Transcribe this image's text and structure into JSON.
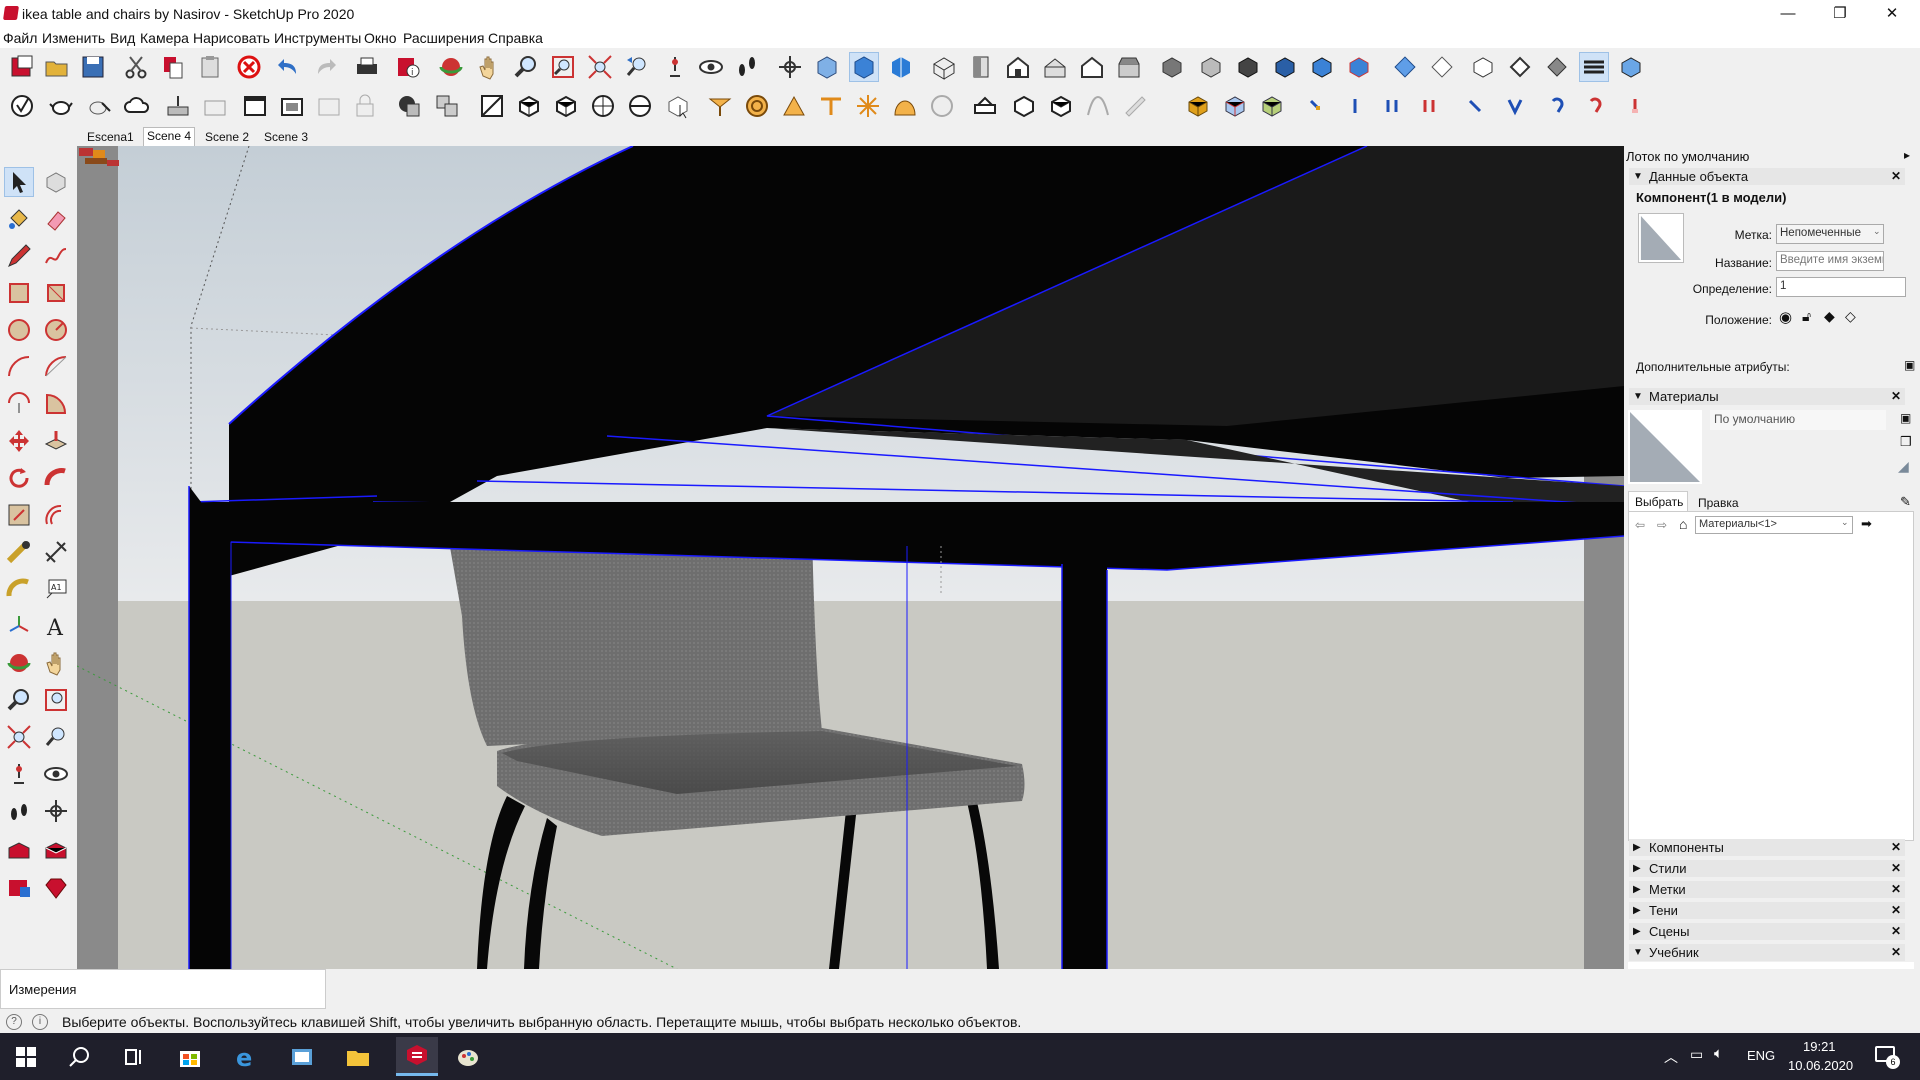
{
  "window": {
    "title": "ikea table and chairs by Nasirov - SketchUp Pro 2020",
    "minimize_glyph": "—",
    "maximize_glyph": "❐",
    "close_glyph": "✕"
  },
  "menu": [
    "Файл",
    "Изменить",
    "Вид",
    "Камера",
    "Нарисовать",
    "Инструменты",
    "Окно",
    "Расширения",
    "Справка"
  ],
  "scenes": {
    "tabs": [
      "Escena1",
      "Scene 4",
      "Scene 2",
      "Scene 3"
    ],
    "active": "Scene 4"
  },
  "tray": {
    "title": "Лоток по умолчанию",
    "entity_info": {
      "header": "Данные объекта",
      "component_title": "Компонент(1 в модели)",
      "tag_label": "Метка:",
      "tag_value": "Непомеченные",
      "name_label": "Название:",
      "name_placeholder": "Введите имя экземпляра",
      "definition_label": "Определение:",
      "definition_value": "1",
      "position_label": "Положение:",
      "extra_attributes": "Дополнительные атрибуты:"
    },
    "materials": {
      "header": "Материалы",
      "default_name": "По умолчанию",
      "tab_select": "Выбрать",
      "tab_edit": "Правка",
      "library": "Материалы<1>"
    },
    "collapsed_panels": [
      "Компоненты",
      "Стили",
      "Метки",
      "Тени",
      "Сцены"
    ],
    "instructor": {
      "header": "Учебник"
    }
  },
  "measurements_label": "Измерения",
  "status_text": "Выберите объекты. Воспользуйтесь клавишей Shift, чтобы увеличить выбранную область. Перетащите мышь, чтобы выбрать несколько объектов.",
  "taskbar": {
    "language": "ENG",
    "time": "19:21",
    "date": "10.06.2020",
    "notifications": "6"
  },
  "colors": {
    "selection_edge": "#1a1aff",
    "table_black": "#050505",
    "seat_fabric": "#6e6e6e",
    "sketchup_red": "#c8102e",
    "taskbar_bg": "#1f1f2b"
  }
}
